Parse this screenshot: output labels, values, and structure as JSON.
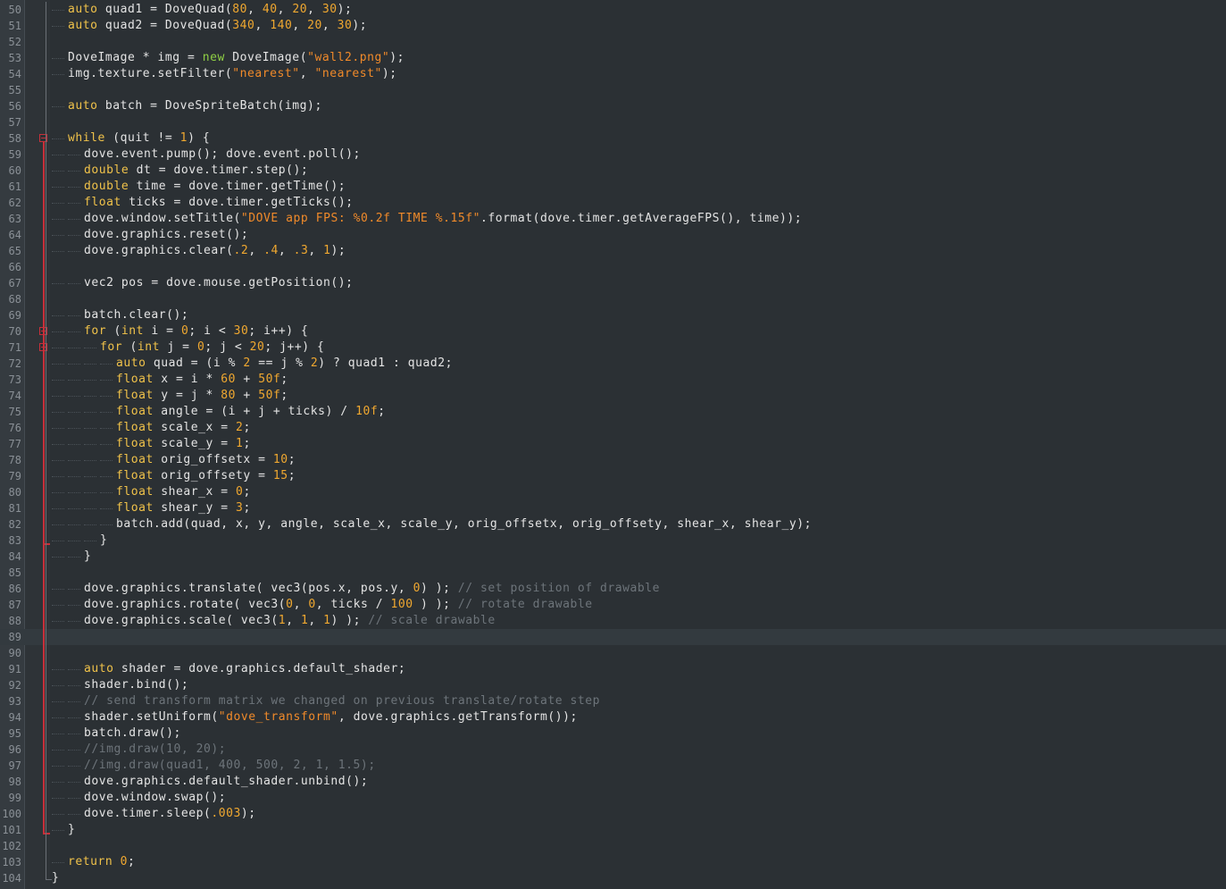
{
  "editor": {
    "theme_colors": {
      "background": "#2b3034",
      "keyword": "#f0c24a",
      "number": "#f0a830",
      "string": "#f08a2a",
      "comment": "#6d747a",
      "new_keyword": "#8fcf44",
      "fold_marker": "#c8303a"
    },
    "current_line": 89,
    "lines": [
      {
        "n": "50",
        "indent": 1,
        "tokens": [
          [
            "kw",
            "auto"
          ],
          [
            "id",
            " quad1 = DoveQuad("
          ],
          [
            "num",
            "80"
          ],
          [
            "id",
            ", "
          ],
          [
            "num",
            "40"
          ],
          [
            "id",
            ", "
          ],
          [
            "num",
            "20"
          ],
          [
            "id",
            ", "
          ],
          [
            "num",
            "30"
          ],
          [
            "id",
            ");"
          ]
        ]
      },
      {
        "n": "51",
        "indent": 1,
        "tokens": [
          [
            "kw",
            "auto"
          ],
          [
            "id",
            " quad2 = DoveQuad("
          ],
          [
            "num",
            "340"
          ],
          [
            "id",
            ", "
          ],
          [
            "num",
            "140"
          ],
          [
            "id",
            ", "
          ],
          [
            "num",
            "20"
          ],
          [
            "id",
            ", "
          ],
          [
            "num",
            "30"
          ],
          [
            "id",
            ");"
          ]
        ]
      },
      {
        "n": "52",
        "indent": 0,
        "tokens": []
      },
      {
        "n": "53",
        "indent": 1,
        "tokens": [
          [
            "id",
            "DoveImage * img = "
          ],
          [
            "newkw",
            "new"
          ],
          [
            "id",
            " DoveImage("
          ],
          [
            "str",
            "\"wall2.png\""
          ],
          [
            "id",
            ");"
          ]
        ]
      },
      {
        "n": "54",
        "indent": 1,
        "tokens": [
          [
            "id",
            "img.texture.setFilter("
          ],
          [
            "str",
            "\"nearest\""
          ],
          [
            "id",
            ", "
          ],
          [
            "str",
            "\"nearest\""
          ],
          [
            "id",
            ");"
          ]
        ]
      },
      {
        "n": "55",
        "indent": 0,
        "tokens": []
      },
      {
        "n": "56",
        "indent": 1,
        "tokens": [
          [
            "kw",
            "auto"
          ],
          [
            "id",
            " batch = DoveSpriteBatch(img);"
          ]
        ]
      },
      {
        "n": "57",
        "indent": 0,
        "tokens": []
      },
      {
        "n": "58",
        "indent": 1,
        "fold": true,
        "tokens": [
          [
            "kw",
            "while"
          ],
          [
            "id",
            " (quit != "
          ],
          [
            "num",
            "1"
          ],
          [
            "id",
            ") {"
          ]
        ]
      },
      {
        "n": "59",
        "indent": 2,
        "tokens": [
          [
            "id",
            "dove.event.pump(); dove.event.poll();"
          ]
        ]
      },
      {
        "n": "60",
        "indent": 2,
        "tokens": [
          [
            "kw",
            "double"
          ],
          [
            "id",
            " dt = dove.timer.step();"
          ]
        ]
      },
      {
        "n": "61",
        "indent": 2,
        "tokens": [
          [
            "kw",
            "double"
          ],
          [
            "id",
            " time = dove.timer.getTime();"
          ]
        ]
      },
      {
        "n": "62",
        "indent": 2,
        "tokens": [
          [
            "kw",
            "float"
          ],
          [
            "id",
            " ticks = dove.timer.getTicks();"
          ]
        ]
      },
      {
        "n": "63",
        "indent": 2,
        "tokens": [
          [
            "id",
            "dove.window.setTitle("
          ],
          [
            "str",
            "\"DOVE app FPS: %0.2f TIME %.15f\""
          ],
          [
            "id",
            ".format(dove.timer.getAverageFPS(), time));"
          ]
        ]
      },
      {
        "n": "64",
        "indent": 2,
        "tokens": [
          [
            "id",
            "dove.graphics.reset();"
          ]
        ]
      },
      {
        "n": "65",
        "indent": 2,
        "tokens": [
          [
            "id",
            "dove.graphics.clear("
          ],
          [
            "num",
            ".2"
          ],
          [
            "id",
            ", "
          ],
          [
            "num",
            ".4"
          ],
          [
            "id",
            ", "
          ],
          [
            "num",
            ".3"
          ],
          [
            "id",
            ", "
          ],
          [
            "num",
            "1"
          ],
          [
            "id",
            ");"
          ]
        ]
      },
      {
        "n": "66",
        "indent": 0,
        "tokens": []
      },
      {
        "n": "67",
        "indent": 2,
        "tokens": [
          [
            "id",
            "vec2 pos = dove.mouse.getPosition();"
          ]
        ]
      },
      {
        "n": "68",
        "indent": 0,
        "tokens": []
      },
      {
        "n": "69",
        "indent": 2,
        "tokens": [
          [
            "id",
            "batch.clear();"
          ]
        ]
      },
      {
        "n": "70",
        "indent": 2,
        "fold": true,
        "tokens": [
          [
            "kw",
            "for"
          ],
          [
            "id",
            " ("
          ],
          [
            "kw",
            "int"
          ],
          [
            "id",
            " i = "
          ],
          [
            "num",
            "0"
          ],
          [
            "id",
            "; i < "
          ],
          [
            "num",
            "30"
          ],
          [
            "id",
            "; i++) {"
          ]
        ]
      },
      {
        "n": "71",
        "indent": 3,
        "fold": true,
        "tokens": [
          [
            "kw",
            "for"
          ],
          [
            "id",
            " ("
          ],
          [
            "kw",
            "int"
          ],
          [
            "id",
            " j = "
          ],
          [
            "num",
            "0"
          ],
          [
            "id",
            "; j < "
          ],
          [
            "num",
            "20"
          ],
          [
            "id",
            "; j++) {"
          ]
        ]
      },
      {
        "n": "72",
        "indent": 4,
        "tokens": [
          [
            "kw",
            "auto"
          ],
          [
            "id",
            " quad = (i % "
          ],
          [
            "num",
            "2"
          ],
          [
            "id",
            " == j % "
          ],
          [
            "num",
            "2"
          ],
          [
            "id",
            ") ? quad1 : quad2;"
          ]
        ]
      },
      {
        "n": "73",
        "indent": 4,
        "tokens": [
          [
            "kw",
            "float"
          ],
          [
            "id",
            " x = i * "
          ],
          [
            "num",
            "60"
          ],
          [
            "id",
            " + "
          ],
          [
            "num",
            "50f"
          ],
          [
            "id",
            ";"
          ]
        ]
      },
      {
        "n": "74",
        "indent": 4,
        "tokens": [
          [
            "kw",
            "float"
          ],
          [
            "id",
            " y = j * "
          ],
          [
            "num",
            "80"
          ],
          [
            "id",
            " + "
          ],
          [
            "num",
            "50f"
          ],
          [
            "id",
            ";"
          ]
        ]
      },
      {
        "n": "75",
        "indent": 4,
        "tokens": [
          [
            "kw",
            "float"
          ],
          [
            "id",
            " angle = (i + j + ticks) / "
          ],
          [
            "num",
            "10f"
          ],
          [
            "id",
            ";"
          ]
        ]
      },
      {
        "n": "76",
        "indent": 4,
        "tokens": [
          [
            "kw",
            "float"
          ],
          [
            "id",
            " scale_x = "
          ],
          [
            "num",
            "2"
          ],
          [
            "id",
            ";"
          ]
        ]
      },
      {
        "n": "77",
        "indent": 4,
        "tokens": [
          [
            "kw",
            "float"
          ],
          [
            "id",
            " scale_y = "
          ],
          [
            "num",
            "1"
          ],
          [
            "id",
            ";"
          ]
        ]
      },
      {
        "n": "78",
        "indent": 4,
        "tokens": [
          [
            "kw",
            "float"
          ],
          [
            "id",
            " orig_offsetx = "
          ],
          [
            "num",
            "10"
          ],
          [
            "id",
            ";"
          ]
        ]
      },
      {
        "n": "79",
        "indent": 4,
        "tokens": [
          [
            "kw",
            "float"
          ],
          [
            "id",
            " orig_offsety = "
          ],
          [
            "num",
            "15"
          ],
          [
            "id",
            ";"
          ]
        ]
      },
      {
        "n": "80",
        "indent": 4,
        "tokens": [
          [
            "kw",
            "float"
          ],
          [
            "id",
            " shear_x = "
          ],
          [
            "num",
            "0"
          ],
          [
            "id",
            ";"
          ]
        ]
      },
      {
        "n": "81",
        "indent": 4,
        "tokens": [
          [
            "kw",
            "float"
          ],
          [
            "id",
            " shear_y = "
          ],
          [
            "num",
            "3"
          ],
          [
            "id",
            ";"
          ]
        ]
      },
      {
        "n": "82",
        "indent": 4,
        "tokens": [
          [
            "id",
            "batch.add(quad, x, y, angle, scale_x, scale_y, orig_offsetx, orig_offsety, shear_x, shear_y);"
          ]
        ]
      },
      {
        "n": "83",
        "indent": 3,
        "foldend": true,
        "tokens": [
          [
            "id",
            "}"
          ]
        ]
      },
      {
        "n": "84",
        "indent": 2,
        "tokens": [
          [
            "id",
            "}"
          ]
        ]
      },
      {
        "n": "85",
        "indent": 0,
        "tokens": []
      },
      {
        "n": "86",
        "indent": 2,
        "tokens": [
          [
            "id",
            "dove.graphics.translate( vec3(pos.x, pos.y, "
          ],
          [
            "num",
            "0"
          ],
          [
            "id",
            ") ); "
          ],
          [
            "cm",
            "// set position of drawable"
          ]
        ]
      },
      {
        "n": "87",
        "indent": 2,
        "tokens": [
          [
            "id",
            "dove.graphics.rotate( vec3("
          ],
          [
            "num",
            "0"
          ],
          [
            "id",
            ", "
          ],
          [
            "num",
            "0"
          ],
          [
            "id",
            ", ticks / "
          ],
          [
            "num",
            "100"
          ],
          [
            "id",
            " ) ); "
          ],
          [
            "cm",
            "// rotate drawable"
          ]
        ]
      },
      {
        "n": "88",
        "indent": 2,
        "tokens": [
          [
            "id",
            "dove.graphics.scale( vec3("
          ],
          [
            "num",
            "1"
          ],
          [
            "id",
            ", "
          ],
          [
            "num",
            "1"
          ],
          [
            "id",
            ", "
          ],
          [
            "num",
            "1"
          ],
          [
            "id",
            ") ); "
          ],
          [
            "cm",
            "// scale drawable"
          ]
        ]
      },
      {
        "n": "89",
        "indent": 0,
        "tokens": []
      },
      {
        "n": "90",
        "indent": 0,
        "tokens": []
      },
      {
        "n": "91",
        "indent": 2,
        "tokens": [
          [
            "kw",
            "auto"
          ],
          [
            "id",
            " shader = dove.graphics.default_shader;"
          ]
        ]
      },
      {
        "n": "92",
        "indent": 2,
        "tokens": [
          [
            "id",
            "shader.bind();"
          ]
        ]
      },
      {
        "n": "93",
        "indent": 2,
        "tokens": [
          [
            "cm",
            "// send transform matrix we changed on previous translate/rotate step"
          ]
        ]
      },
      {
        "n": "94",
        "indent": 2,
        "tokens": [
          [
            "id",
            "shader.setUniform("
          ],
          [
            "str",
            "\"dove_transform\""
          ],
          [
            "id",
            ", dove.graphics.getTransform());"
          ]
        ]
      },
      {
        "n": "95",
        "indent": 2,
        "tokens": [
          [
            "id",
            "batch.draw();"
          ]
        ]
      },
      {
        "n": "96",
        "indent": 2,
        "tokens": [
          [
            "cm",
            "//img.draw(10, 20);"
          ]
        ]
      },
      {
        "n": "97",
        "indent": 2,
        "tokens": [
          [
            "cm",
            "//img.draw(quad1, 400, 500, 2, 1, 1.5);"
          ]
        ]
      },
      {
        "n": "98",
        "indent": 2,
        "tokens": [
          [
            "id",
            "dove.graphics.default_shader.unbind();"
          ]
        ]
      },
      {
        "n": "99",
        "indent": 2,
        "tokens": [
          [
            "id",
            "dove.window.swap();"
          ]
        ]
      },
      {
        "n": "100",
        "indent": 2,
        "tokens": [
          [
            "id",
            "dove.timer.sleep("
          ],
          [
            "num",
            ".003"
          ],
          [
            "id",
            ");"
          ]
        ]
      },
      {
        "n": "101",
        "indent": 1,
        "foldend": true,
        "tokens": [
          [
            "id",
            "}"
          ]
        ]
      },
      {
        "n": "102",
        "indent": 0,
        "tokens": []
      },
      {
        "n": "103",
        "indent": 1,
        "tokens": [
          [
            "kw",
            "return"
          ],
          [
            "id",
            " "
          ],
          [
            "num",
            "0"
          ],
          [
            "id",
            ";"
          ]
        ]
      },
      {
        "n": "104",
        "indent": 0,
        "foldend": true,
        "tokens": [
          [
            "id",
            "}"
          ]
        ]
      }
    ]
  }
}
